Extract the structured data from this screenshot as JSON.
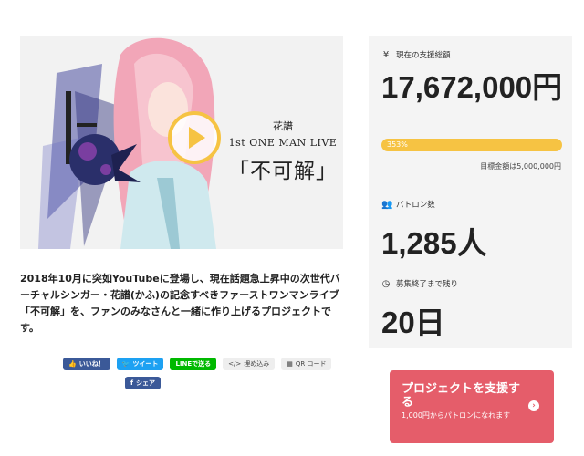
{
  "video": {
    "poster_artist": "花譜",
    "poster_subtitle": "1st ONE MAN LIVE",
    "poster_title": "「不可解」"
  },
  "description": "2018年10月に突如YouTubeに登場し、現在話題急上昇中の次世代バーチャルシンガー・花譜(かふ)の記念すべきファーストワンマンライブ「不可解」を、ファンのみなさんと一緒に作り上げるプロジェクトです。",
  "share": {
    "facebook_like": "いいね！",
    "tweet": "ツイート",
    "line": "LINEで送る",
    "embed": "埋め込み",
    "qr": "QR コード",
    "facebook_share": "シェア"
  },
  "stats": {
    "total_label": "現在の支援総額",
    "total_amount": "17,672,000円",
    "progress_label": "353%",
    "progress_value": 3.53,
    "goal_text": "目標金額は5,000,000円",
    "patrons_label": "パトロン数",
    "patrons_value": "1,285人",
    "remaining_label": "募集終了まで残り",
    "remaining_value": "20日"
  },
  "support": {
    "title": "プロジェクトを支援する",
    "subtitle": "1,000円からパトロンになれます"
  },
  "colors": {
    "accent_yellow": "#f6c343",
    "support_red": "#e55d6a",
    "stats_bg": "#f4f4f4"
  },
  "icons": {
    "total": "yen-icon",
    "patrons": "people-icon",
    "remaining": "clock-icon",
    "arrow": "chevron-right-icon",
    "play": "play-icon"
  }
}
